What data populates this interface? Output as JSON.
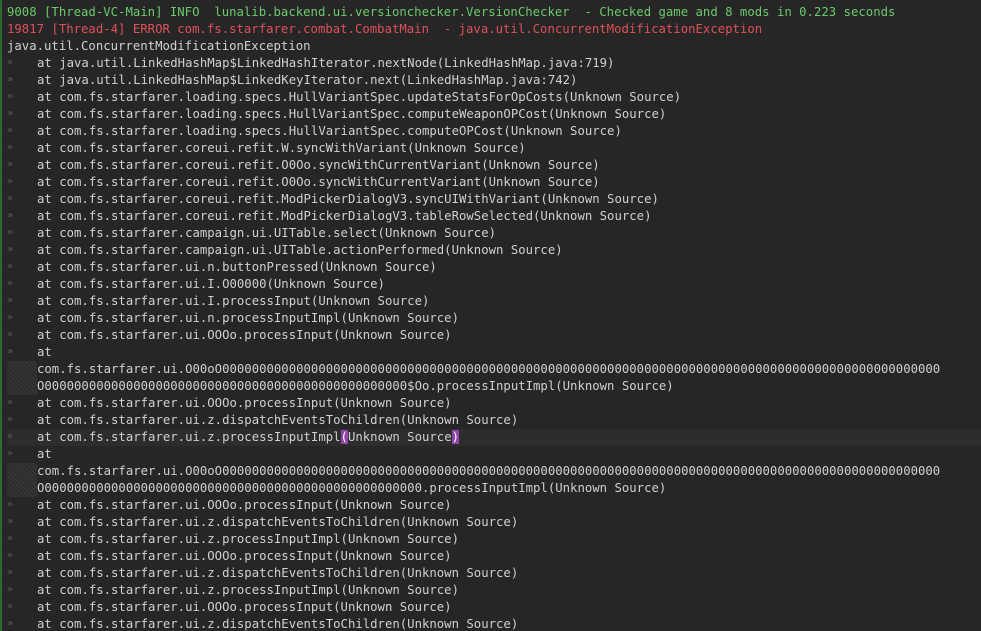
{
  "theme": {
    "background": "#262626",
    "text": "#d0d0d0",
    "info": "#6cc96c",
    "error": "#e0505a",
    "accent_bar": "#2f6b2f",
    "bracket_highlight": "#8e44a8",
    "gutter_marker": "»"
  },
  "log": {
    "lines": [
      {
        "text": "9008 [Thread-VC-Main] INFO  lunalib.backend.ui.versionchecker.VersionChecker  - Checked game and 8 mods in 0.223 seconds",
        "level": "info",
        "gutter": false
      },
      {
        "text": "19817 [Thread-4] ERROR com.fs.starfarer.combat.CombatMain  - java.util.ConcurrentModificationException",
        "level": "error",
        "gutter": false
      },
      {
        "text": "java.util.ConcurrentModificationException",
        "level": "plain",
        "gutter": false
      },
      {
        "text": "at java.util.LinkedHashMap$LinkedHashIterator.nextNode(LinkedHashMap.java:719)",
        "level": "plain",
        "gutter": true
      },
      {
        "text": "at java.util.LinkedHashMap$LinkedKeyIterator.next(LinkedHashMap.java:742)",
        "level": "plain",
        "gutter": true
      },
      {
        "text": "at com.fs.starfarer.loading.specs.HullVariantSpec.updateStatsForOpCosts(Unknown Source)",
        "level": "plain",
        "gutter": true
      },
      {
        "text": "at com.fs.starfarer.loading.specs.HullVariantSpec.computeWeaponOPCost(Unknown Source)",
        "level": "plain",
        "gutter": true
      },
      {
        "text": "at com.fs.starfarer.loading.specs.HullVariantSpec.computeOPCost(Unknown Source)",
        "level": "plain",
        "gutter": true
      },
      {
        "text": "at com.fs.starfarer.coreui.refit.W.syncWithVariant(Unknown Source)",
        "level": "plain",
        "gutter": true
      },
      {
        "text": "at com.fs.starfarer.coreui.refit.O0Oo.syncWithCurrentVariant(Unknown Source)",
        "level": "plain",
        "gutter": true
      },
      {
        "text": "at com.fs.starfarer.coreui.refit.O0Oo.syncWithCurrentVariant(Unknown Source)",
        "level": "plain",
        "gutter": true
      },
      {
        "text": "at com.fs.starfarer.coreui.refit.ModPickerDialogV3.syncUIWithVariant(Unknown Source)",
        "level": "plain",
        "gutter": true
      },
      {
        "text": "at com.fs.starfarer.coreui.refit.ModPickerDialogV3.tableRowSelected(Unknown Source)",
        "level": "plain",
        "gutter": true
      },
      {
        "text": "at com.fs.starfarer.campaign.ui.UITable.select(Unknown Source)",
        "level": "plain",
        "gutter": true
      },
      {
        "text": "at com.fs.starfarer.campaign.ui.UITable.actionPerformed(Unknown Source)",
        "level": "plain",
        "gutter": true
      },
      {
        "text": "at com.fs.starfarer.ui.n.buttonPressed(Unknown Source)",
        "level": "plain",
        "gutter": true
      },
      {
        "text": "at com.fs.starfarer.ui.I.O00000(Unknown Source)",
        "level": "plain",
        "gutter": true
      },
      {
        "text": "at com.fs.starfarer.ui.I.processInput(Unknown Source)",
        "level": "plain",
        "gutter": true
      },
      {
        "text": "at com.fs.starfarer.ui.n.processInputImpl(Unknown Source)",
        "level": "plain",
        "gutter": true
      },
      {
        "text": "at com.fs.starfarer.ui.OOOo.processInput(Unknown Source)",
        "level": "plain",
        "gutter": true
      },
      {
        "text": "at",
        "level": "plain",
        "gutter": true
      },
      {
        "text": "com.fs.starfarer.ui.O00oO0000000000000000000000000000000000000000000000000000000000000000000000000000000000000000000000000",
        "level": "plain",
        "gutter": "hatched"
      },
      {
        "text": "O0000000000000000000000000000000000000000000000000$Oo.processInputImpl(Unknown Source)",
        "level": "plain",
        "gutter": "hatched"
      },
      {
        "text": "at com.fs.starfarer.ui.OOOo.processInput(Unknown Source)",
        "level": "plain",
        "gutter": true
      },
      {
        "text": "at com.fs.starfarer.ui.z.dispatchEventsToChildren(Unknown Source)",
        "level": "plain",
        "gutter": true
      },
      {
        "text": "at com.fs.starfarer.ui.z.processInputImpl",
        "level": "plain",
        "gutter": true,
        "highlight": true,
        "bracket_open": "(",
        "bracket_inner": "Unknown Source",
        "bracket_close": ")"
      },
      {
        "text": "at",
        "level": "plain",
        "gutter": true
      },
      {
        "text": "com.fs.starfarer.ui.O00oO0000000000000000000000000000000000000000000000000000000000000000000000000000000000000000000000000",
        "level": "plain",
        "gutter": "hatched"
      },
      {
        "text": "O000000000000000000000000000000000000000000000000000.processInputImpl(Unknown Source)",
        "level": "plain",
        "gutter": "hatched"
      },
      {
        "text": "at com.fs.starfarer.ui.OOOo.processInput(Unknown Source)",
        "level": "plain",
        "gutter": true
      },
      {
        "text": "at com.fs.starfarer.ui.z.dispatchEventsToChildren(Unknown Source)",
        "level": "plain",
        "gutter": true
      },
      {
        "text": "at com.fs.starfarer.ui.z.processInputImpl(Unknown Source)",
        "level": "plain",
        "gutter": true
      },
      {
        "text": "at com.fs.starfarer.ui.OOOo.processInput(Unknown Source)",
        "level": "plain",
        "gutter": true
      },
      {
        "text": "at com.fs.starfarer.ui.z.dispatchEventsToChildren(Unknown Source)",
        "level": "plain",
        "gutter": true
      },
      {
        "text": "at com.fs.starfarer.ui.z.processInputImpl(Unknown Source)",
        "level": "plain",
        "gutter": true
      },
      {
        "text": "at com.fs.starfarer.ui.OOOo.processInput(Unknown Source)",
        "level": "plain",
        "gutter": true
      },
      {
        "text": "at com.fs.starfarer.ui.z.dispatchEventsToChildren(Unknown Source)",
        "level": "plain",
        "gutter": true
      }
    ]
  }
}
